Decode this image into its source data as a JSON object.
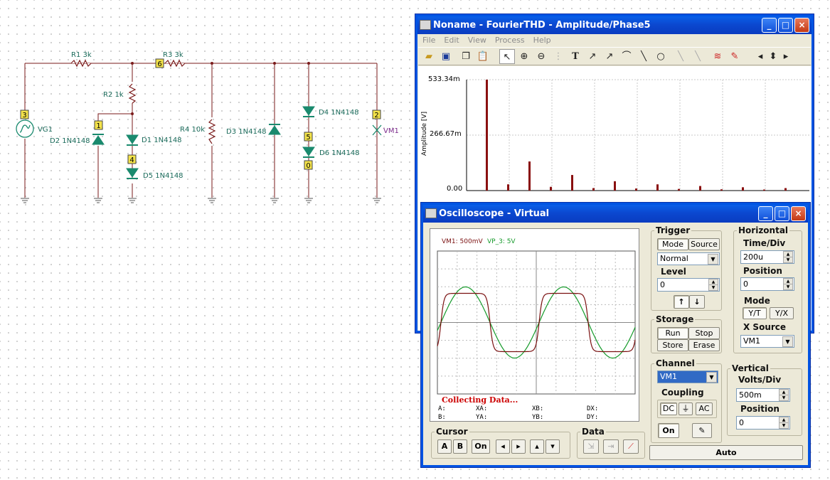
{
  "schematic": {
    "resistors": [
      {
        "name": "R1",
        "value": "3k"
      },
      {
        "name": "R2",
        "value": "1k"
      },
      {
        "name": "R3",
        "value": "3k"
      },
      {
        "name": "R4",
        "value": "10k"
      }
    ],
    "diodes": [
      {
        "name": "D1",
        "value": "1N4148"
      },
      {
        "name": "D2",
        "value": "1N4148"
      },
      {
        "name": "D3",
        "value": "1N4148"
      },
      {
        "name": "D4",
        "value": "1N4148"
      },
      {
        "name": "D5",
        "value": "1N4148"
      },
      {
        "name": "D6",
        "value": "1N4148"
      }
    ],
    "sources": {
      "vg": "VG1",
      "vm": "VM1"
    },
    "nodes": {
      "n6": "6",
      "n3": "3",
      "n1": "1",
      "n4": "4",
      "n2": "2",
      "n5": "5",
      "n0": "0"
    }
  },
  "fourier": {
    "title": "Noname - FourierTHD - Amplitude/Phase5",
    "menu": [
      "File",
      "Edit",
      "View",
      "Process",
      "Help"
    ],
    "ylabel": "Amplitude [V]",
    "yticks": [
      "533.34m",
      "266.67m",
      "0.00"
    ],
    "chart_data": {
      "type": "bar",
      "ylabel": "Amplitude [V]",
      "ylim": [
        0,
        0.53334
      ],
      "unit": "V",
      "values": [
        0.53334,
        0.03,
        0.14,
        0.018,
        0.075,
        0.012,
        0.045,
        0.01,
        0.03,
        0.008,
        0.022,
        0.006,
        0.016,
        0.005,
        0.012
      ]
    }
  },
  "osc": {
    "title": "Oscilloscope - Virtual",
    "legend": {
      "ch1": "VM1: 500mV",
      "ch2": "VP_3: 5V"
    },
    "status": "Collecting Data...",
    "cursor_readouts": [
      "A:",
      "XA:",
      "XB:",
      "DX:",
      "B:",
      "YA:",
      "YB:",
      "DY:"
    ],
    "trigger": {
      "label": "Trigger",
      "mode": "Mode",
      "source": "Source",
      "mode_value": "Normal",
      "level_label": "Level",
      "level_value": "0"
    },
    "storage": {
      "label": "Storage",
      "run": "Run",
      "stop": "Stop",
      "store": "Store",
      "erase": "Erase"
    },
    "horizontal": {
      "label": "Horizontal",
      "timediv_label": "Time/Div",
      "timediv": "200u",
      "position_label": "Position",
      "position": "0",
      "mode_label": "Mode",
      "yt": "Y/T",
      "yx": "Y/X",
      "xsource_label": "X Source",
      "xsource": "VM1"
    },
    "channel": {
      "label": "Channel",
      "value": "VM1",
      "coupling_label": "Coupling",
      "dc": "DC",
      "ac": "AC",
      "on": "On"
    },
    "vertical": {
      "label": "Vertical",
      "voltsdiv_label": "Volts/Div",
      "voltsdiv": "500m",
      "position_label": "Position",
      "position": "0"
    },
    "cursor": {
      "label": "Cursor",
      "a": "A",
      "b": "B",
      "on": "On"
    },
    "data_label": "Data",
    "auto": "Auto",
    "colors": {
      "ch1": "#7a1010",
      "ch2": "#159a2a"
    }
  }
}
